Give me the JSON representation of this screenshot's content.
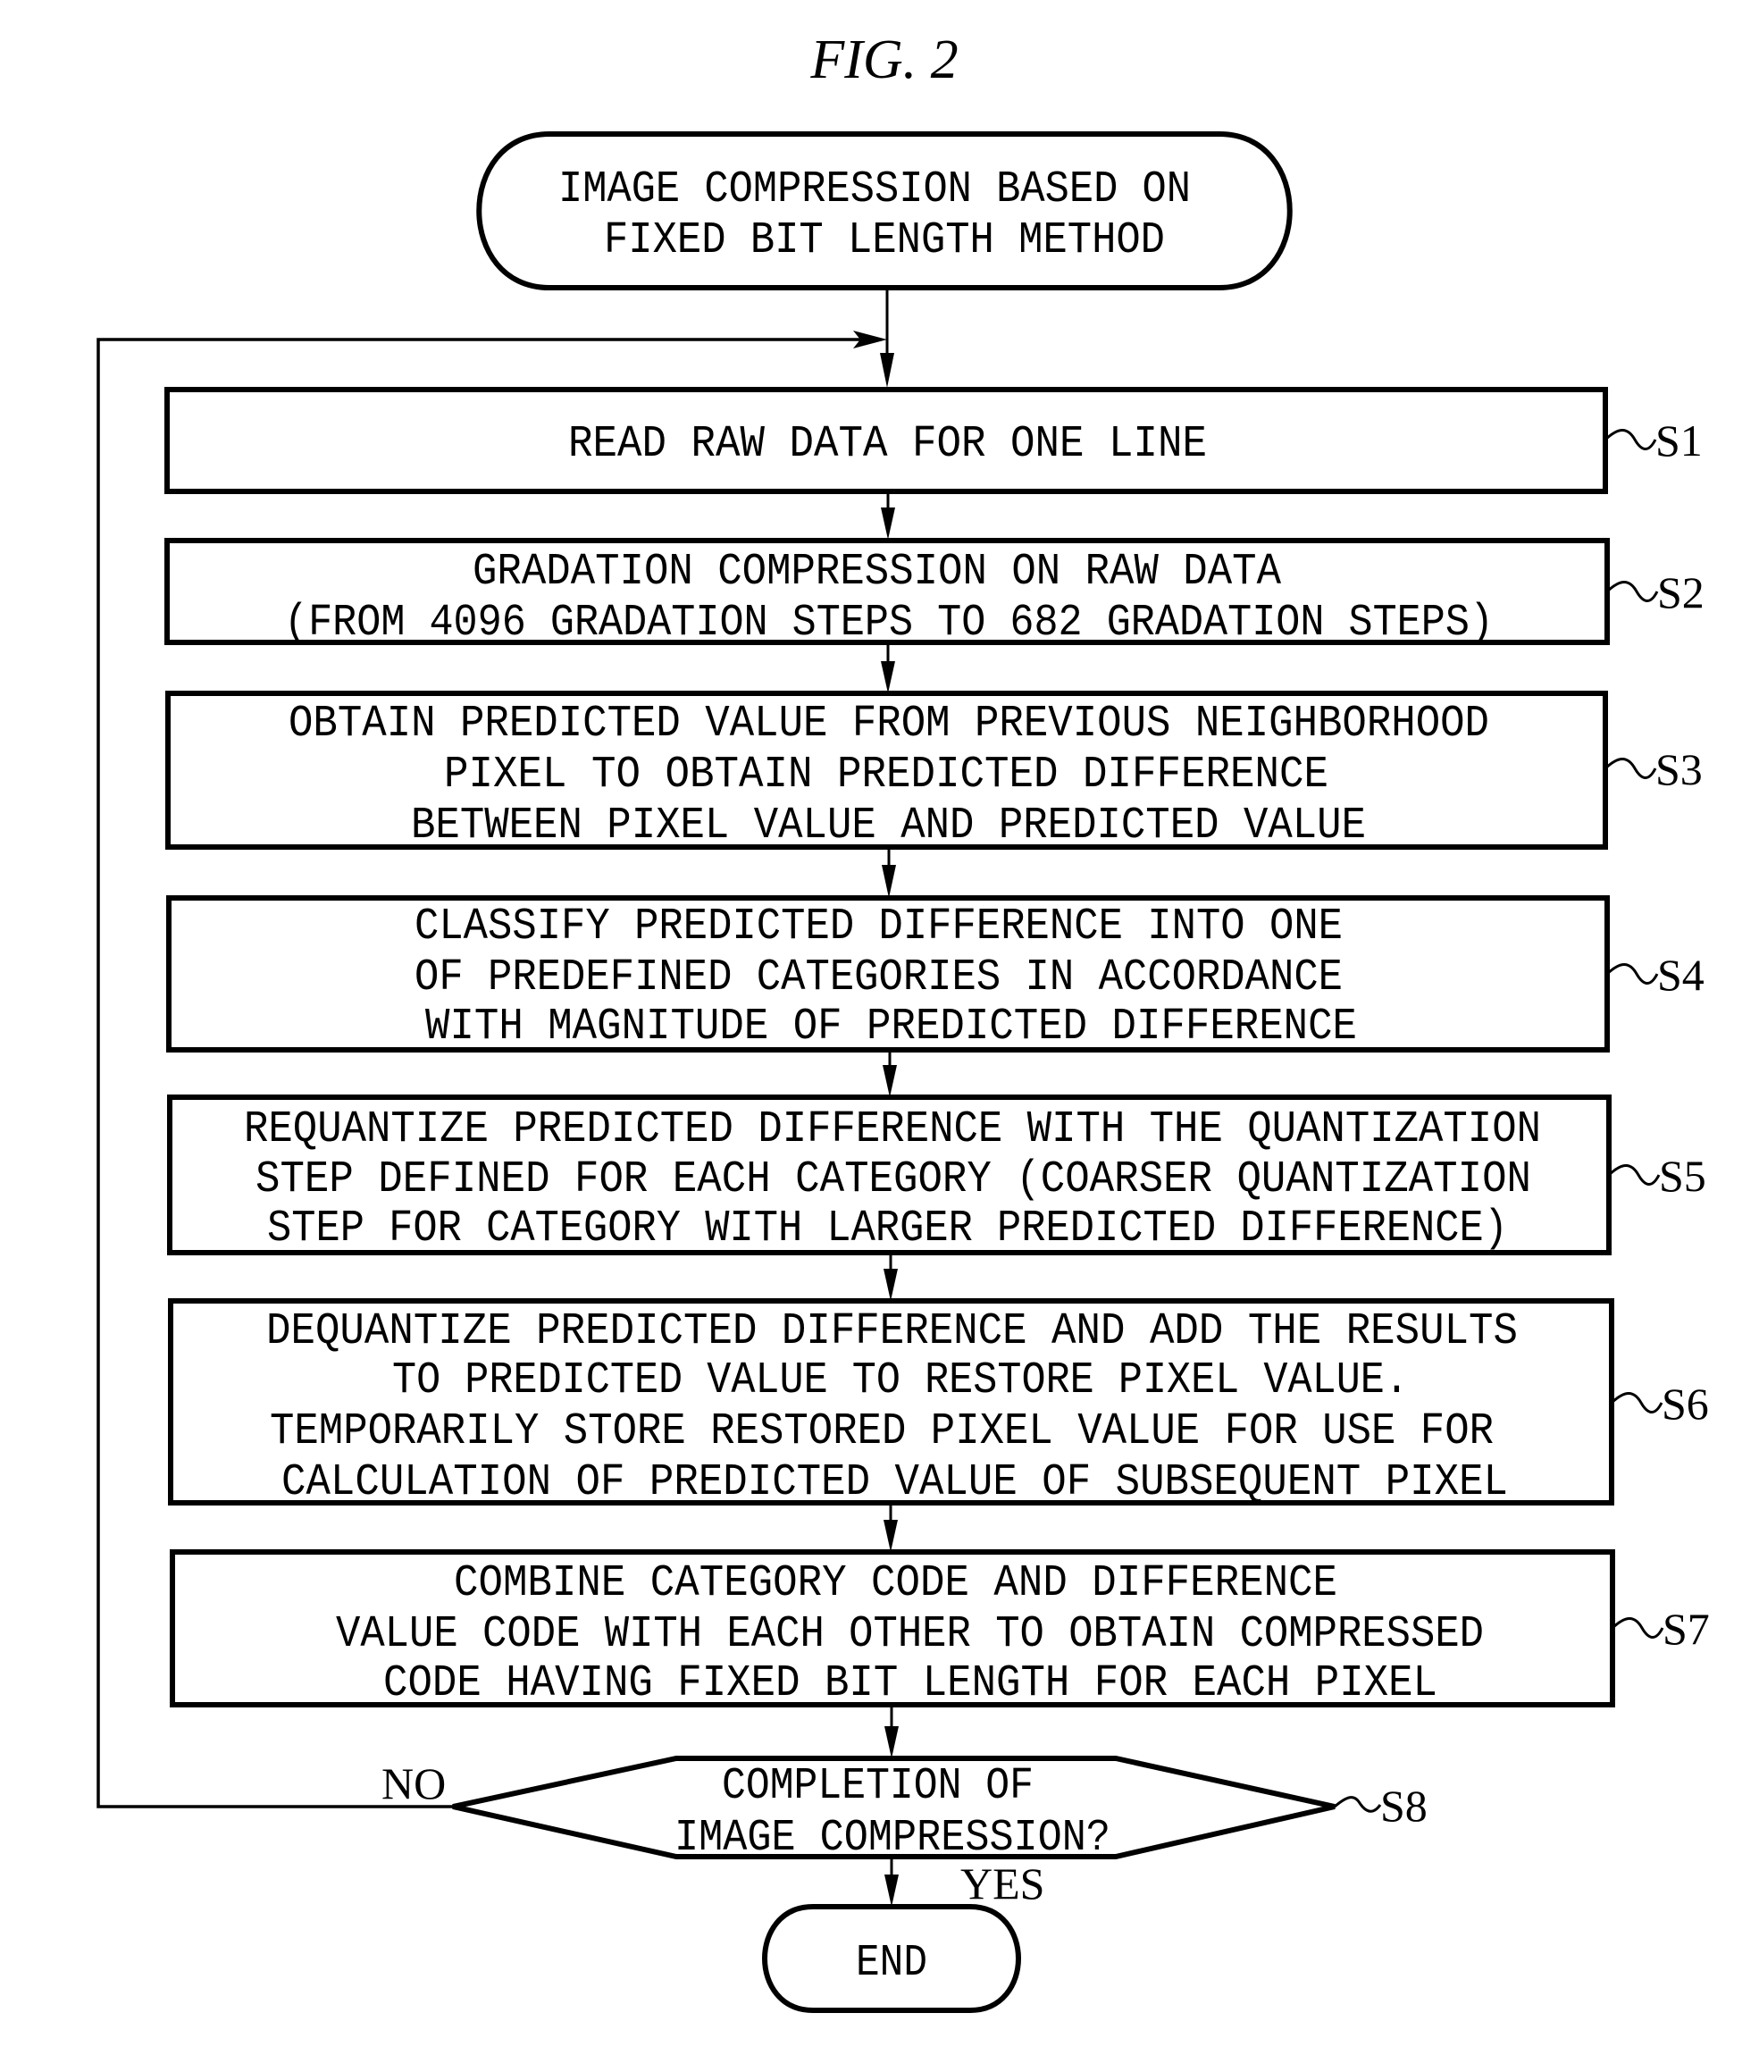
{
  "figure": {
    "title": "FIG. 2"
  },
  "start": {
    "lines": [
      "IMAGE COMPRESSION BASED ON",
      "FIXED BIT LENGTH METHOD"
    ]
  },
  "steps": [
    {
      "id": "S1",
      "label": "S1",
      "lines": [
        "READ RAW DATA FOR ONE LINE"
      ]
    },
    {
      "id": "S2",
      "label": "S2",
      "lines": [
        "GRADATION COMPRESSION ON RAW DATA",
        "(FROM 4096 GRADATION STEPS TO 682 GRADATION STEPS)"
      ]
    },
    {
      "id": "S3",
      "label": "S3",
      "lines": [
        "OBTAIN PREDICTED VALUE FROM PREVIOUS NEIGHBORHOOD",
        "PIXEL TO OBTAIN PREDICTED DIFFERENCE",
        "BETWEEN PIXEL VALUE AND PREDICTED VALUE"
      ]
    },
    {
      "id": "S4",
      "label": "S4",
      "lines": [
        "CLASSIFY PREDICTED DIFFERENCE INTO ONE",
        "OF PREDEFINED CATEGORIES IN ACCORDANCE",
        "WITH MAGNITUDE OF PREDICTED DIFFERENCE"
      ]
    },
    {
      "id": "S5",
      "label": "S5",
      "lines": [
        "REQUANTIZE PREDICTED DIFFERENCE WITH THE QUANTIZATION",
        "STEP DEFINED FOR EACH CATEGORY (COARSER QUANTIZATION",
        "STEP FOR CATEGORY WITH LARGER PREDICTED DIFFERENCE)"
      ]
    },
    {
      "id": "S6",
      "label": "S6",
      "lines": [
        "DEQUANTIZE PREDICTED DIFFERENCE AND ADD THE RESULTS",
        "TO PREDICTED VALUE TO RESTORE PIXEL VALUE.",
        "TEMPORARILY STORE RESTORED PIXEL VALUE FOR USE FOR",
        "CALCULATION OF PREDICTED VALUE OF SUBSEQUENT PIXEL"
      ]
    },
    {
      "id": "S7",
      "label": "S7",
      "lines": [
        "COMBINE CATEGORY CODE AND DIFFERENCE",
        "VALUE CODE WITH EACH OTHER TO OBTAIN COMPRESSED",
        "CODE HAVING FIXED BIT LENGTH FOR EACH PIXEL"
      ]
    }
  ],
  "decision": {
    "id": "S8",
    "label": "S8",
    "lines": [
      "COMPLETION OF",
      "IMAGE COMPRESSION?"
    ],
    "no_label": "NO",
    "yes_label": "YES"
  },
  "end": {
    "label": "END"
  }
}
